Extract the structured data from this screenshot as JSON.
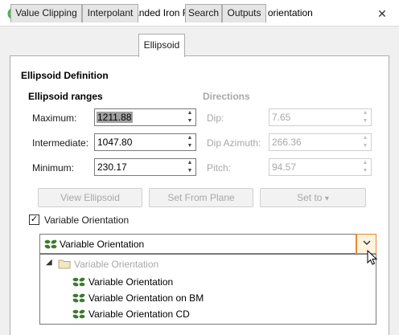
{
  "window": {
    "title": "Edit Kriging - Kr, Lower Banded Iron Formation_variable orientation",
    "close_glyph": "✕"
  },
  "tabs": [
    {
      "label": "Value Clipping"
    },
    {
      "label": "Interpolant"
    },
    {
      "label": "Ellipsoid"
    },
    {
      "label": "Search"
    },
    {
      "label": "Outputs"
    }
  ],
  "active_tab": "Ellipsoid",
  "ellipsoid": {
    "section_title": "Ellipsoid Definition",
    "ranges_title": "Ellipsoid ranges",
    "directions_title": "Directions",
    "maximum": {
      "label": "Maximum:",
      "value": "1211.88"
    },
    "intermediate": {
      "label": "Intermediate:",
      "value": "1047.80"
    },
    "minimum": {
      "label": "Minimum:",
      "value": "230.17"
    },
    "dip": {
      "label": "Dip:",
      "value": "7.65"
    },
    "dip_azimuth": {
      "label": "Dip Azimuth:",
      "value": "266.36"
    },
    "pitch": {
      "label": "Pitch:",
      "value": "94.57"
    },
    "view_button": "View Ellipsoid",
    "set_from_plane_button": "Set From Plane",
    "set_to_button": "Set to",
    "set_to_arrow": "▾"
  },
  "variable_orientation": {
    "checkbox_label": "Variable Orientation",
    "checked": true,
    "check_glyph": "✓",
    "selected_value": "Variable Orientation",
    "dropdown": {
      "folder": {
        "label": "Variable Orientation",
        "expand_glyph": "◢",
        "enabled": false
      },
      "options": [
        {
          "label": "Variable Orientation"
        },
        {
          "label": "Variable Orientation on BM"
        },
        {
          "label": "Variable Orientation CD"
        }
      ]
    }
  },
  "icons": {
    "app": "leapfrog-app-icon",
    "variable_orientation": "variable-orientation-icon",
    "folder": "folder-icon",
    "chevron": "chevron-down-icon"
  },
  "colors": {
    "accent_orange": "#e08a2e",
    "vo_icon_green": "#3b7d2e",
    "app_icon_green": "#4caf50"
  }
}
